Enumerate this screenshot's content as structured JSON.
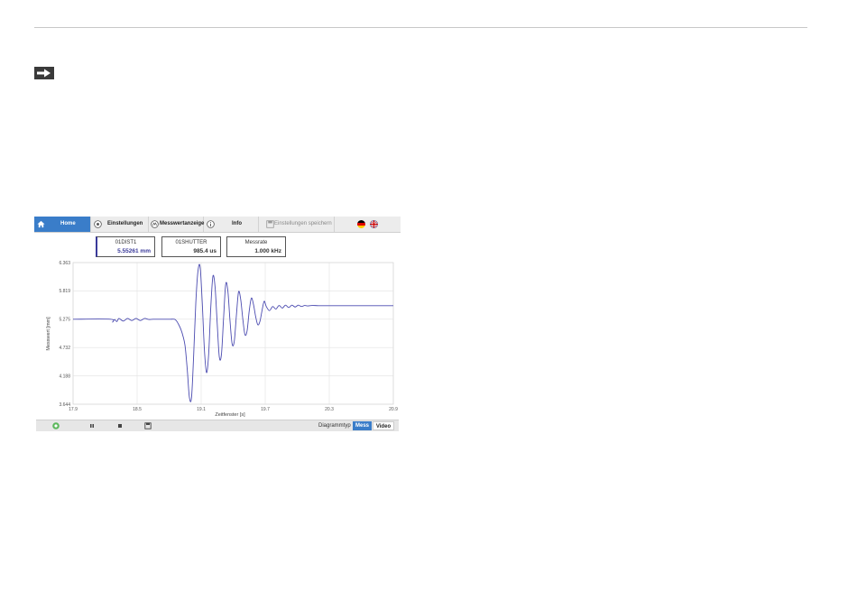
{
  "nav": {
    "home_label": "Home",
    "settings_label": "Einstellungen",
    "display_label": "Messwertanzeige",
    "info_label": "Info",
    "save_label": "Einstellungen speichern"
  },
  "values": [
    {
      "title": "01DIST1",
      "value": "5.55261 mm"
    },
    {
      "title": "01SHUTTER",
      "value": "985.4 us"
    },
    {
      "title": "Messrate",
      "value": "1.000 kHz"
    }
  ],
  "toolbar": {
    "diagram_label": "Diagrammtyp",
    "mode_on": "Mess",
    "mode_off": "Video"
  },
  "chart_data": {
    "type": "line",
    "xlabel": "Zeitfenster [s]",
    "ylabel": "Messwert [mm]",
    "xlim": [
      17.9,
      20.9
    ],
    "ylim": [
      3.644,
      6.363
    ],
    "x_ticks": [
      "17.9",
      "18.5",
      "19.1",
      "19.7",
      "20.3",
      "20.9"
    ],
    "y_ticks": [
      "6.363",
      "5.819",
      "5.275",
      "4.732",
      "4.188",
      "3.644"
    ],
    "grid": true,
    "series": [
      {
        "color": "#4b4bb0",
        "x": [
          17.9,
          18.25,
          18.27,
          18.29,
          18.31,
          18.33,
          18.37,
          18.41,
          18.45,
          18.49,
          18.53,
          18.57,
          18.61,
          18.65,
          18.69,
          18.73,
          18.77,
          18.81,
          18.85,
          18.87,
          18.89,
          18.91,
          18.93,
          18.95,
          18.97,
          18.99,
          19.01,
          19.03,
          19.05,
          19.07,
          19.09,
          19.11,
          19.13,
          19.15,
          19.17,
          19.19,
          19.21,
          19.23,
          19.25,
          19.27,
          19.29,
          19.31,
          19.33,
          19.35,
          19.37,
          19.39,
          19.41,
          19.43,
          19.45,
          19.47,
          19.49,
          19.51,
          19.53,
          19.55,
          19.57,
          19.59,
          19.61,
          19.63,
          19.65,
          19.67,
          19.69,
          19.71,
          19.74,
          19.77,
          19.8,
          19.83,
          19.86,
          19.89,
          19.92,
          19.95,
          19.98,
          20.01,
          20.04,
          20.07,
          20.1,
          20.14,
          20.2,
          20.3,
          20.5,
          20.7,
          20.9
        ],
        "y": [
          5.275,
          5.275,
          5.22,
          5.27,
          5.23,
          5.29,
          5.24,
          5.29,
          5.25,
          5.29,
          5.25,
          5.29,
          5.27,
          5.275,
          5.275,
          5.275,
          5.275,
          5.275,
          5.275,
          5.24,
          5.17,
          5.08,
          4.95,
          4.75,
          4.3,
          3.77,
          3.78,
          4.6,
          5.6,
          6.2,
          6.28,
          5.6,
          4.7,
          4.25,
          4.6,
          5.5,
          6.1,
          5.9,
          5.2,
          4.55,
          4.6,
          5.3,
          5.95,
          5.82,
          5.25,
          4.8,
          4.85,
          5.35,
          5.8,
          5.66,
          5.28,
          4.98,
          5.05,
          5.43,
          5.68,
          5.56,
          5.33,
          5.17,
          5.23,
          5.44,
          5.62,
          5.52,
          5.44,
          5.52,
          5.47,
          5.54,
          5.49,
          5.545,
          5.5,
          5.545,
          5.51,
          5.545,
          5.52,
          5.54,
          5.53,
          5.54,
          5.535,
          5.535,
          5.535,
          5.535,
          5.535
        ]
      }
    ]
  }
}
